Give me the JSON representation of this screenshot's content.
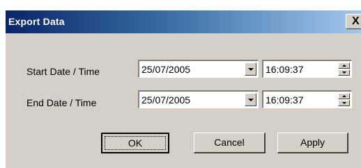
{
  "window": {
    "title": "Export Data",
    "close_label": "X"
  },
  "form": {
    "start_label": "Start Date / Time",
    "end_label": "End Date / Time",
    "start_date": "25/07/2005",
    "start_time": "16:09:37",
    "end_date": "25/07/2005",
    "end_time": "16:09:37"
  },
  "buttons": {
    "ok": "OK",
    "cancel": "Cancel",
    "apply": "Apply"
  },
  "colors": {
    "title_gradient_start": "#0a246a",
    "title_gradient_end": "#a6caf0",
    "dialog_face": "#d4d0c8"
  }
}
